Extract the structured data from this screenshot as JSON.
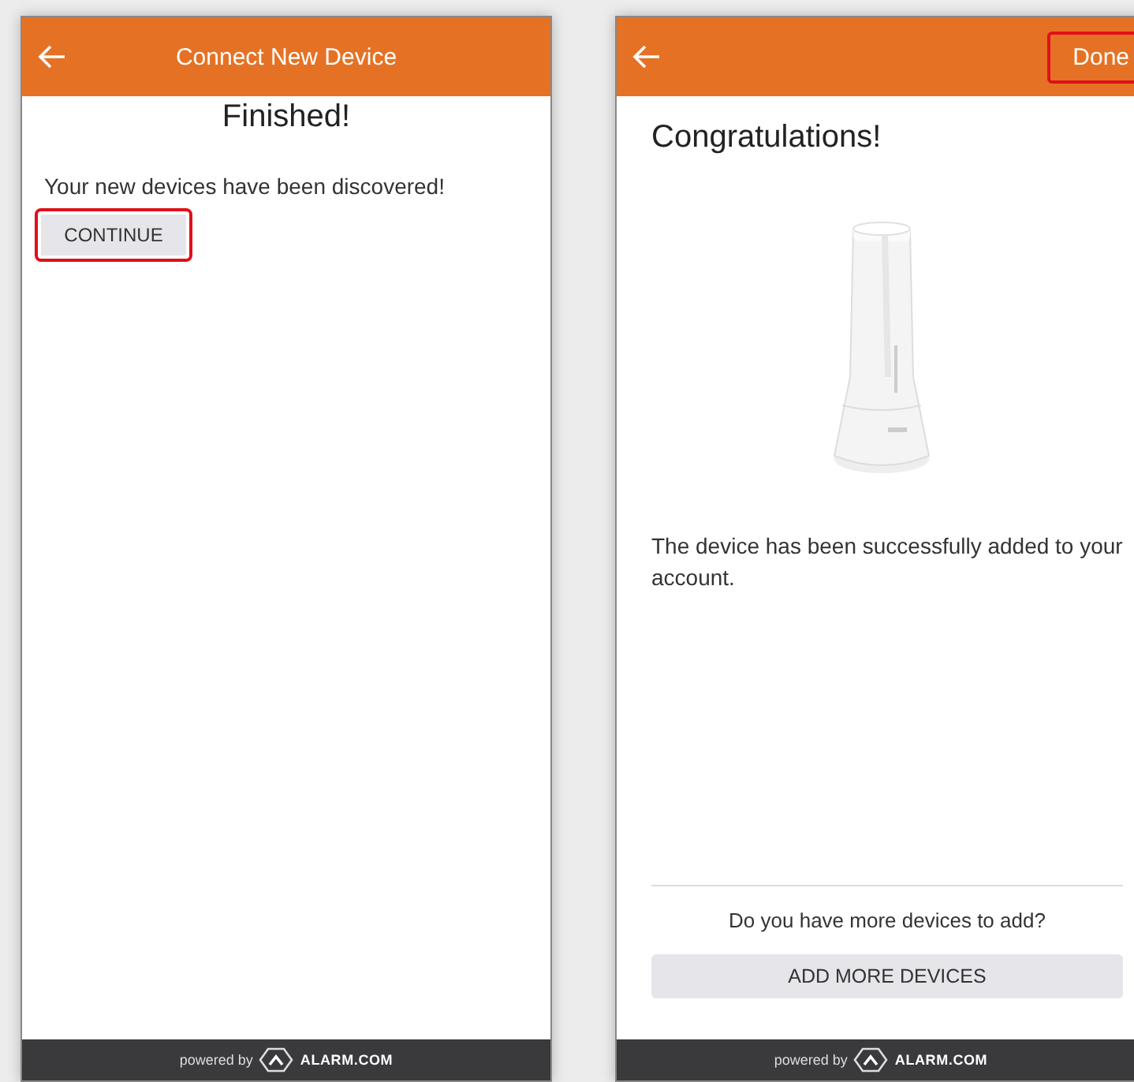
{
  "screens": [
    {
      "kind": "discovered",
      "header": {
        "title": "Connect New Device"
      },
      "heading": "Finished!",
      "message": "Your new devices have been discovered!",
      "button": {
        "label": "CONTINUE",
        "highlighted": true
      },
      "footer": {
        "prefix": "powered by",
        "brand": "ALARM.COM"
      }
    },
    {
      "kind": "success",
      "header": {
        "action": {
          "label": "Done",
          "highlighted": true
        }
      },
      "heading": "Congratulations!",
      "message": "The device has been successfully added to your account.",
      "prompt": "Do you have more devices to add?",
      "button": {
        "label": "ADD MORE DEVICES",
        "highlighted": false
      },
      "footer": {
        "prefix": "powered by",
        "brand": "ALARM.COM"
      }
    }
  ]
}
